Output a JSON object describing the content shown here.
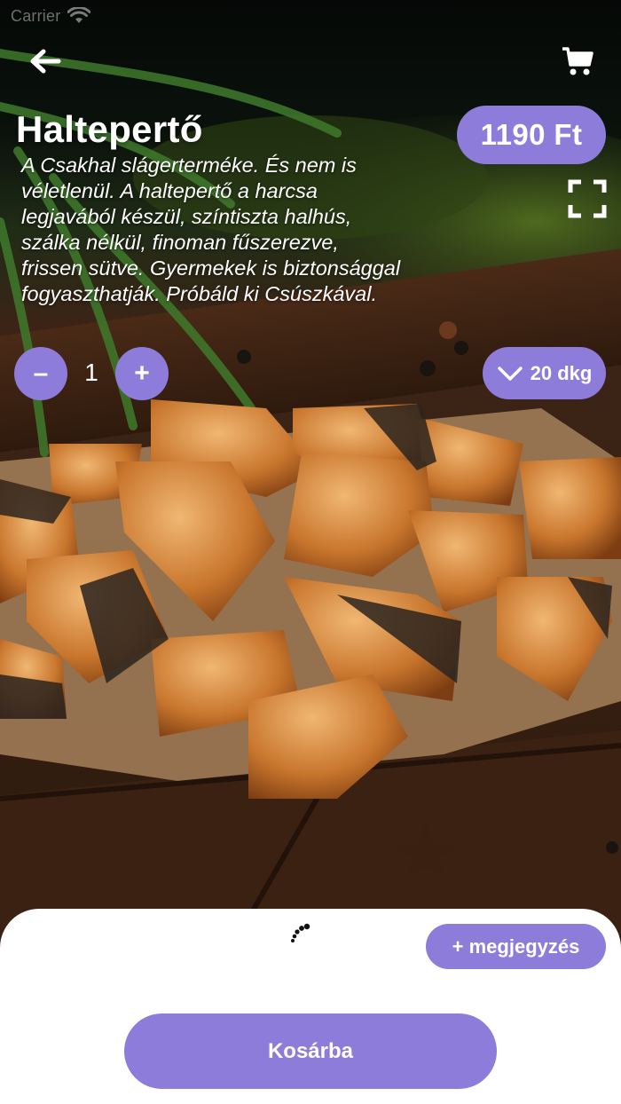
{
  "status_bar": {
    "carrier": "Carrier"
  },
  "product": {
    "title": "Haltepertő",
    "description": "A Csakhal slágerterméke. És nem is véletlenül. A haltepertő a harcsa legjavából készül, színtiszta halhús, szálka nélkül, finoman fűszerezve, frissen sütve. Gyermekek is biztonsággal fogyaszthatják. Próbáld ki Csúszkával.",
    "price": "1190 Ft"
  },
  "quantity": {
    "minus_label": "–",
    "value": "1",
    "plus_label": "+"
  },
  "unit": {
    "label": "20 dkg",
    "icon": "chevron-down-icon"
  },
  "actions": {
    "note_label": "+ megjegyzés",
    "add_to_basket_label": "Kosárba"
  },
  "icons": {
    "back": "arrow-left-icon",
    "cart": "cart-icon",
    "expand": "fullscreen-icon",
    "loading": "spinner-icon"
  },
  "colors": {
    "accent": "#8e7cdb",
    "sheet": "#ffffff",
    "text_on_photo": "#ffffff"
  }
}
